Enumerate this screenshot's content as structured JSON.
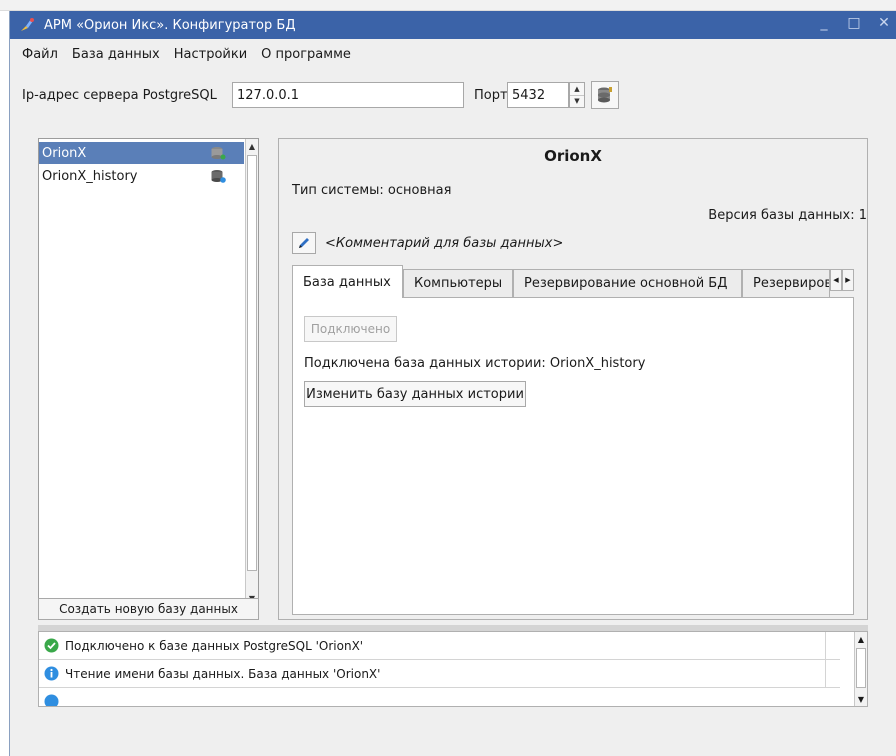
{
  "window": {
    "title": "АРМ «Орион Икс». Конфигуратор БД",
    "controls": {
      "minimize": "_",
      "maximize": "□",
      "close": "✕"
    }
  },
  "menu": [
    {
      "label": "Файл"
    },
    {
      "label": "База данных"
    },
    {
      "label": "Настройки"
    },
    {
      "label": "О программе"
    }
  ],
  "connection": {
    "ip_label": "Ip-адрес сервера PostgreSQL",
    "ip_value": "127.0.0.1",
    "port_label": "Порт",
    "port_value": "5432"
  },
  "databases": {
    "items": [
      {
        "name": "OrionX",
        "selected": true,
        "icon": "database-green-icon"
      },
      {
        "name": "OrionX_history",
        "selected": false,
        "icon": "database-info-icon"
      }
    ],
    "create_button": "Создать новую базу данных"
  },
  "details": {
    "title": "OrionX",
    "system_type": "Тип системы: основная",
    "db_version": "Версия базы данных: 1",
    "comment": "<Комментарий для базы данных>",
    "tabs": [
      {
        "label": "База данных",
        "active": true
      },
      {
        "label": "Компьютеры",
        "active": false
      },
      {
        "label": "Резервирование основной БД",
        "active": false
      },
      {
        "label": "Резервирование",
        "active": false
      }
    ],
    "connected_button": "Подключено",
    "history_text": "Подключена база данных истории: OrionX_history",
    "change_history_button": "Изменить базу данных истории"
  },
  "log": [
    {
      "icon": "check-circle-icon",
      "text": "Подключено к базе данных PostgreSQL 'OrionX'"
    },
    {
      "icon": "info-circle-icon",
      "text": "Чтение имени базы данных. База данных 'OrionX'"
    }
  ],
  "colors": {
    "titlebar": "#3b63a8",
    "selection": "#5a7fb8",
    "success": "#3aa84a",
    "info": "#2f8ee0"
  }
}
